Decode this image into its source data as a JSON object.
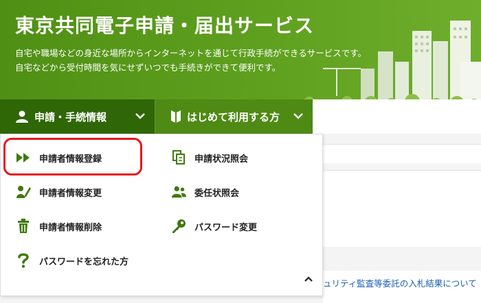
{
  "header": {
    "title": "東京共同電子申請・届出サービス",
    "description_line1": "自宅や職場などの身近な場所からインターネットを通じて行政手続ができるサービスです。",
    "description_line2": "自宅などから受付時間を気にせずいつでも手続きができて便利です。"
  },
  "nav": {
    "item1_label": "申請・手続情報",
    "item2_label": "はじめて利用する方"
  },
  "dropdown": {
    "items": [
      {
        "label": "申請者情報登録",
        "icon": "fast-forward-icon"
      },
      {
        "label": "申請状況照会",
        "icon": "documents-icon"
      },
      {
        "label": "申請者情報変更",
        "icon": "user-edit-icon"
      },
      {
        "label": "委任状照会",
        "icon": "users-icon"
      },
      {
        "label": "申請者情報削除",
        "icon": "trash-icon"
      },
      {
        "label": "パスワード変更",
        "icon": "key-icon"
      },
      {
        "label": "パスワードを忘れた方",
        "icon": "question-icon"
      }
    ]
  },
  "background": {
    "news_link": "ュリティ監査等委託の入札結果について"
  },
  "colors": {
    "brand_green": "#5fa01f",
    "nav_dark": "#2f6606",
    "icon_green": "#3f7a0c",
    "highlight_red": "#e8141b"
  }
}
